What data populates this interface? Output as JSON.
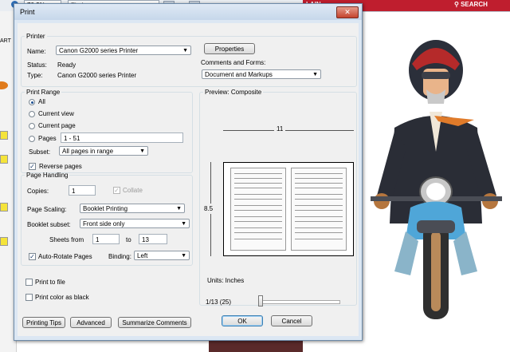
{
  "app": {
    "zoom": "70.3%",
    "find_placeholder": "Find",
    "site_left": "LAIN",
    "site_search": "SEARCH",
    "page_fragment": "ART"
  },
  "dialog": {
    "title": "Print",
    "close_glyph": "✕",
    "printer": {
      "group": "Printer",
      "name_label": "Name:",
      "name_value": "Canon G2000 series Printer",
      "status_label": "Status:",
      "status_value": "Ready",
      "type_label": "Type:",
      "type_value": "Canon G2000 series Printer",
      "properties_button": "Properties",
      "comments_label": "Comments and Forms:",
      "comments_value": "Document and Markups"
    },
    "print_range": {
      "group": "Print Range",
      "all": "All",
      "current_view": "Current view",
      "current_page": "Current page",
      "pages": "Pages",
      "pages_value": "1 - 51",
      "subset_label": "Subset:",
      "subset_value": "All pages in range",
      "reverse_pages": "Reverse pages"
    },
    "page_handling": {
      "group": "Page Handling",
      "copies_label": "Copies:",
      "copies_value": "1",
      "collate": "Collate",
      "scaling_label": "Page Scaling:",
      "scaling_value": "Booklet Printing",
      "booklet_subset_label": "Booklet subset:",
      "booklet_subset_value": "Front side only",
      "sheets_from_label": "Sheets from",
      "sheets_from_value": "1",
      "sheets_to_label": "to",
      "sheets_to_value": "13",
      "auto_rotate": "Auto-Rotate Pages",
      "binding_label": "Binding:",
      "binding_value": "Left"
    },
    "options": {
      "print_to_file": "Print to file",
      "print_black": "Print color as black"
    },
    "preview": {
      "group": "Preview: Composite",
      "width_label": "11",
      "height_label": "8.5",
      "units": "Units: Inches",
      "page_indicator": "1/13 (25)"
    },
    "buttons": {
      "printing_tips": "Printing Tips",
      "advanced": "Advanced",
      "summarize": "Summarize Comments",
      "ok": "OK",
      "cancel": "Cancel"
    }
  },
  "colors": {
    "site_red": "#bf1e2e",
    "dialog_frame": "#dce7f3",
    "dialog_client": "#f0f0f0"
  }
}
